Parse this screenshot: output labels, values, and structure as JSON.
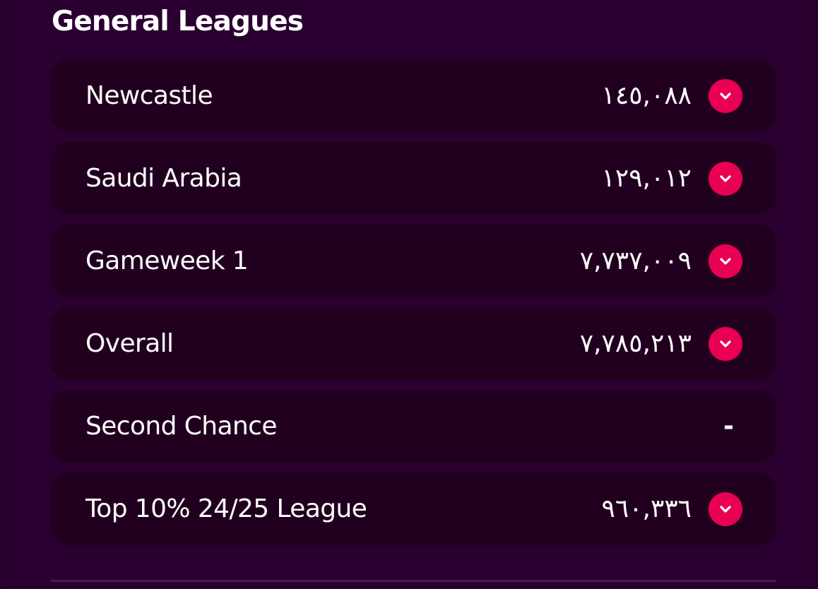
{
  "section": {
    "title": "General Leagues"
  },
  "leagues": [
    {
      "name": "Newcastle",
      "rank": "١٤٥,٠٨٨",
      "movement": "down"
    },
    {
      "name": "Saudi Arabia",
      "rank": "١٢٩,٠١٢",
      "movement": "down"
    },
    {
      "name": "Gameweek 1",
      "rank": "٧,٧٣٧,٠٠٩",
      "movement": "down"
    },
    {
      "name": "Overall",
      "rank": "٧,٧٨٥,٢١٣",
      "movement": "down"
    },
    {
      "name": "Second Chance",
      "rank": "-",
      "movement": "none"
    },
    {
      "name": "Top 10% 24/25 League",
      "rank": "٩٦٠,٣٣٦",
      "movement": "down"
    }
  ],
  "icons": {
    "movement_down": "chevron-down-icon"
  },
  "colors": {
    "background": "#2a0030",
    "row_background": "#21001f",
    "movement_down": "#e90052",
    "text": "#ffffff"
  }
}
